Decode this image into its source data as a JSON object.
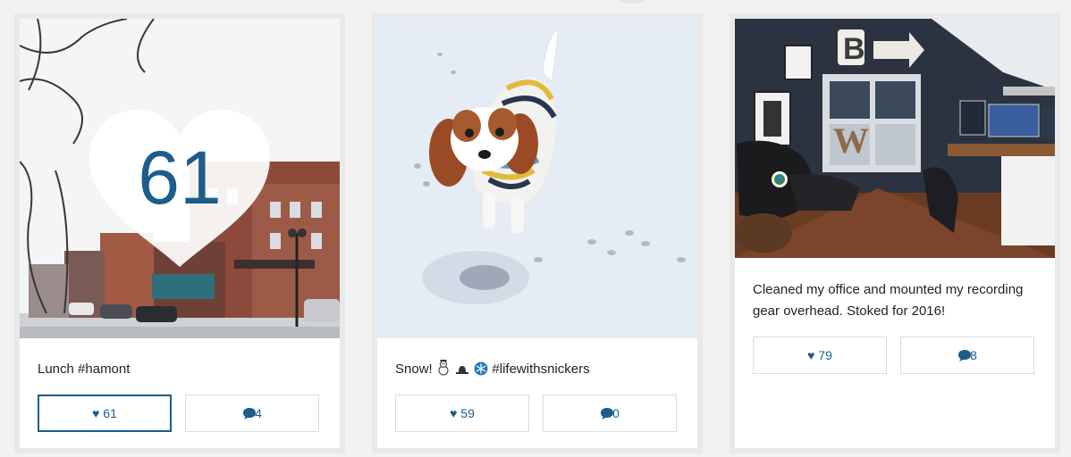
{
  "colors": {
    "accent": "#1c5d8c",
    "border": "#dcdcdc",
    "card_frame": "#e9e9e9"
  },
  "posts": [
    {
      "caption": "Lunch #hamont",
      "overlay_count": "61",
      "likes_label": "♥ 61",
      "comments_count": "4",
      "like_active": true,
      "image": "snowy street with brick buildings"
    },
    {
      "caption_prefix": "Snow!",
      "caption_suffix": "#lifewithsnickers",
      "caption_emoji_icons": [
        "snowman-icon",
        "hat-icon",
        "snowflake-icon"
      ],
      "likes_label": "♥ 59",
      "comments_count": "0",
      "like_active": false,
      "image": "dog in sweater standing in snow"
    },
    {
      "caption": "Cleaned my office and mounted my recording gear overhead. Stoked for 2016!",
      "likes_label": "♥ 79",
      "comments_count": "8",
      "like_active": false,
      "image": "home office with desk, monitors and lounge chair"
    }
  ]
}
